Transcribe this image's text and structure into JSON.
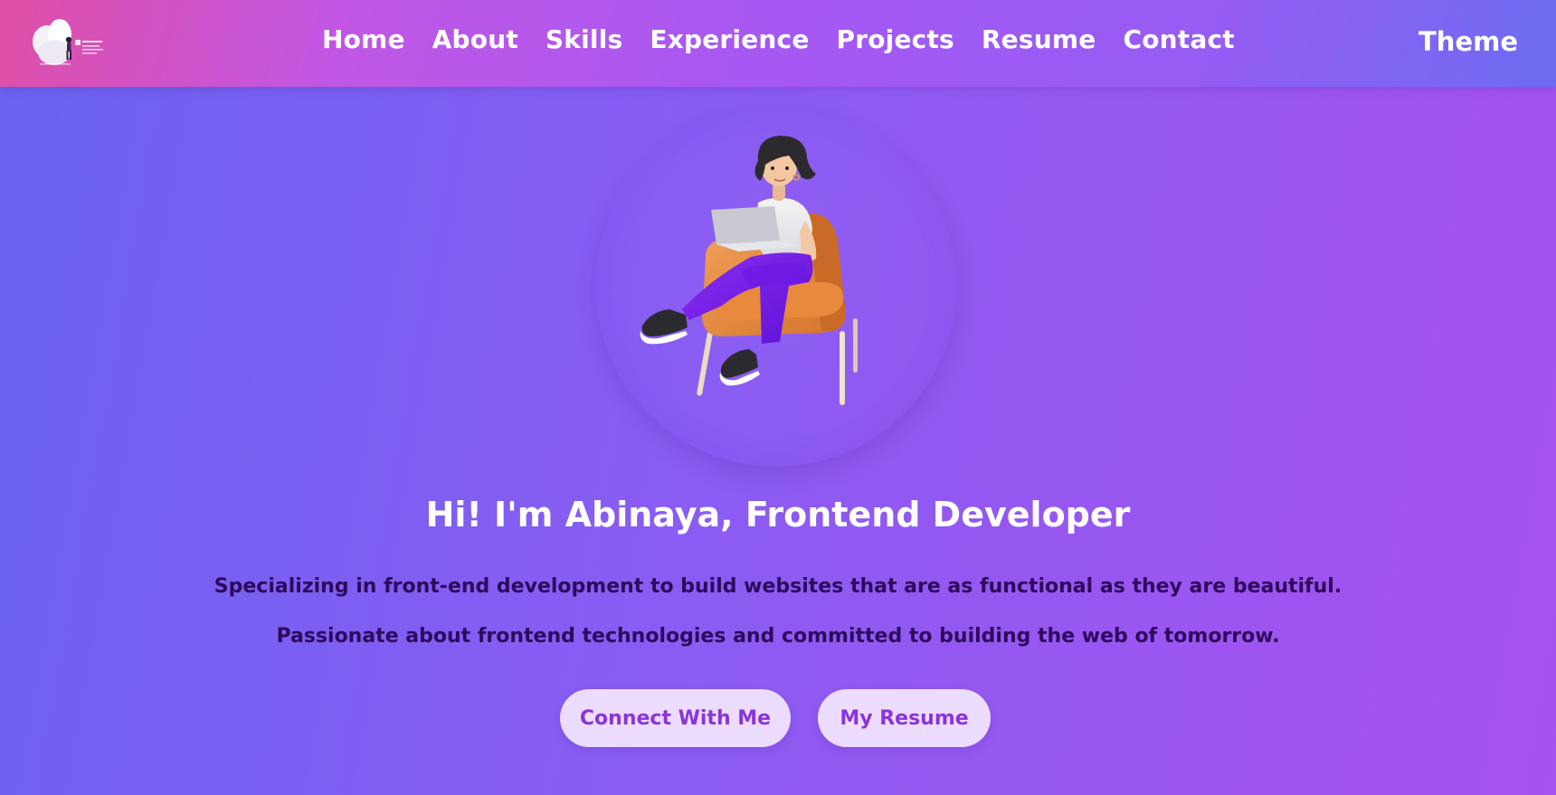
{
  "header": {
    "logo_icon": "logo-illustration-icon",
    "nav": [
      {
        "label": "Home"
      },
      {
        "label": "About"
      },
      {
        "label": "Skills"
      },
      {
        "label": "Experience"
      },
      {
        "label": "Projects"
      },
      {
        "label": "Resume"
      },
      {
        "label": "Contact"
      }
    ],
    "theme_label": "Theme"
  },
  "hero": {
    "avatar_icon": "developer-avatar-illustration",
    "headline": "Hi! I'm Abinaya, Frontend Developer",
    "tagline_1": "Specializing in front-end development to build websites that are as functional as they are beautiful.",
    "tagline_2": "Passionate about frontend technologies and committed to building the web of tomorrow.",
    "buttons": {
      "connect": "Connect With Me",
      "resume": "My Resume"
    }
  },
  "colors": {
    "header_gradient_start": "#e04fa6",
    "header_gradient_end": "#6c6cf1",
    "background_start": "#6a63f0",
    "background_end": "#a751ee",
    "tagline_text": "#2e0a5c",
    "button_bg": "#ecdcff",
    "button_text": "#8a35d8"
  }
}
